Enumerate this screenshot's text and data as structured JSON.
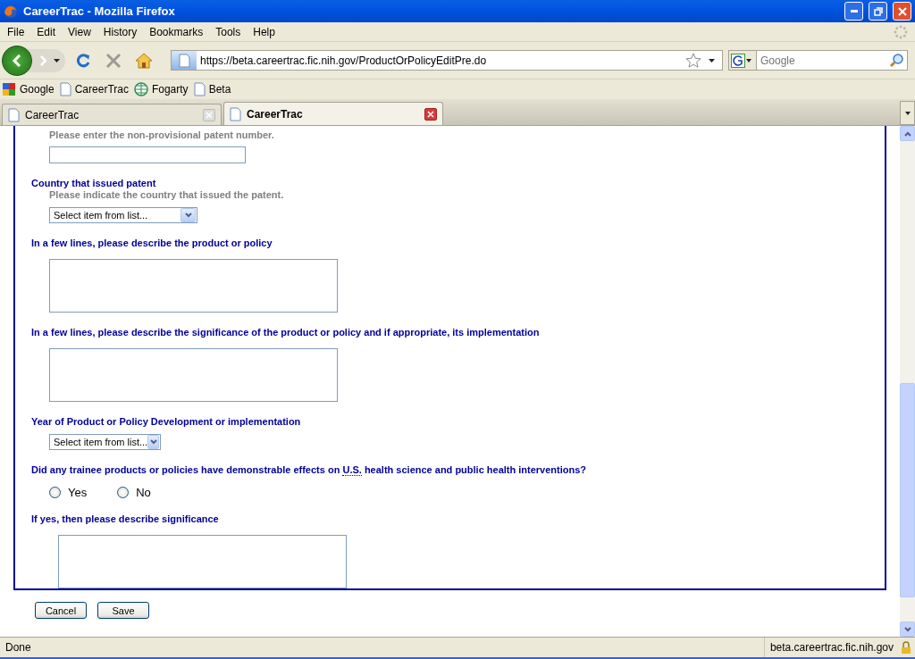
{
  "window": {
    "title": "CareerTrac - Mozilla Firefox"
  },
  "menu": [
    "File",
    "Edit",
    "View",
    "History",
    "Bookmarks",
    "Tools",
    "Help"
  ],
  "address": {
    "value": "https://beta.careertrac.fic.nih.gov/ProductOrPolicyEditPre.do"
  },
  "search": {
    "placeholder": "Google"
  },
  "bookmarks": [
    {
      "label": "Google",
      "kind": "google"
    },
    {
      "label": "CareerTrac",
      "kind": "page"
    },
    {
      "label": "Fogarty",
      "kind": "globe"
    },
    {
      "label": "Beta",
      "kind": "page"
    }
  ],
  "tabs": [
    {
      "label": "CareerTrac",
      "selected": false
    },
    {
      "label": "CareerTrac",
      "selected": true
    }
  ],
  "form": {
    "items": [
      {
        "kind": "hint",
        "text": "Please enter the non-provisional patent number."
      },
      {
        "kind": "text_input"
      },
      {
        "kind": "label",
        "text": "Country that issued patent"
      },
      {
        "kind": "hint",
        "text": "Please indicate the country that issued the patent."
      },
      {
        "kind": "select",
        "value": "Select item from list..."
      },
      {
        "kind": "label",
        "text": "In a few lines, please describe the product or policy"
      },
      {
        "kind": "textarea"
      },
      {
        "kind": "label",
        "text": "In a few lines, please describe the significance of the product or policy and if appropriate, its implementation"
      },
      {
        "kind": "textarea"
      },
      {
        "kind": "label",
        "text": "Year of Product or Policy Development or implementation"
      },
      {
        "kind": "select_short",
        "value": "Select item from list..."
      },
      {
        "kind": "question",
        "parts": [
          {
            "text": "Did any trainee products or policies have demonstrable effects on ",
            "abbr": false
          },
          {
            "text": "U.S.",
            "abbr": true
          },
          {
            "text": " health science and public health interventions?",
            "abbr": false
          }
        ]
      },
      {
        "kind": "radios",
        "options": [
          {
            "label": "Yes",
            "selected": false
          },
          {
            "label": "No",
            "selected": false
          }
        ]
      },
      {
        "kind": "label",
        "text": "If yes, then please describe significance"
      },
      {
        "kind": "textarea_indented"
      }
    ]
  },
  "buttons": [
    "Cancel",
    "Save"
  ],
  "status_bar": {
    "text": "Done",
    "host": "beta.careertrac.fic.nih.gov"
  }
}
